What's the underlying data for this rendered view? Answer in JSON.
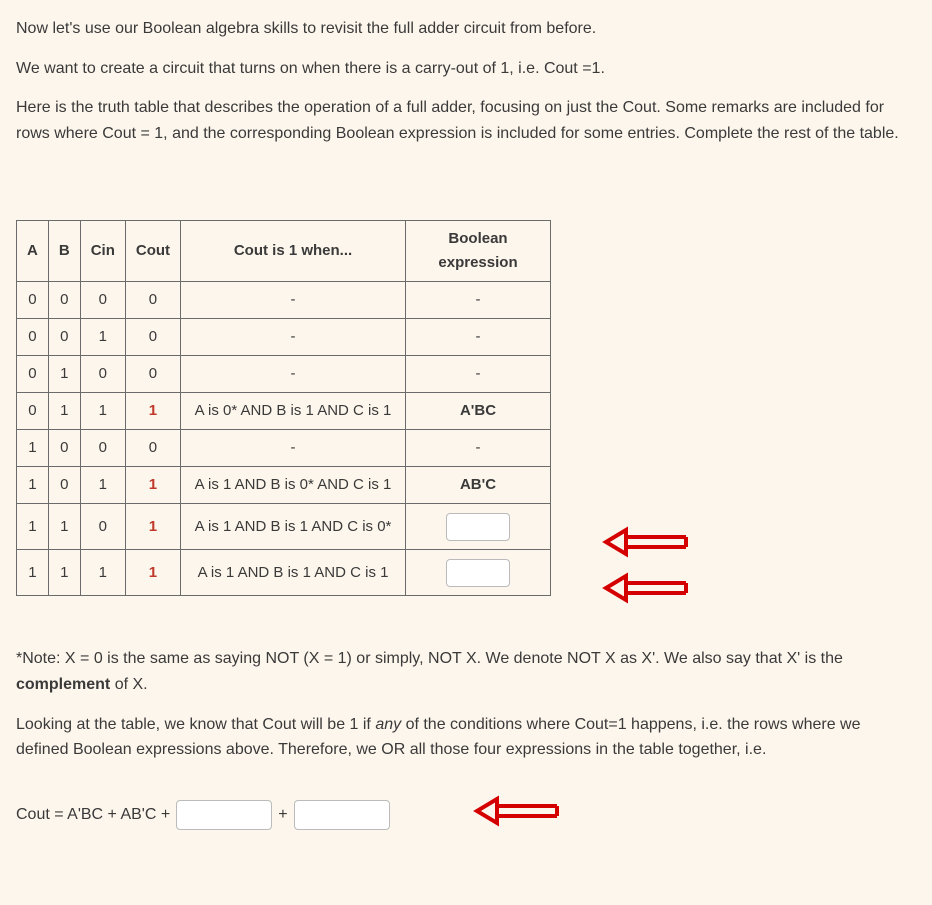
{
  "intro": {
    "p1": "Now let's use our Boolean algebra skills to revisit the full adder circuit from before.",
    "p2": "We want to create a circuit that turns on when there is a carry-out of 1, i.e. Cout =1.",
    "p3": "Here is the truth table that describes the operation of a full adder, focusing on just the Cout. Some remarks are included for rows where Cout = 1, and the corresponding Boolean expression is included for some entries. Complete the rest of the table."
  },
  "table": {
    "headers": {
      "a": "A",
      "b": "B",
      "cin": "Cin",
      "cout": "Cout",
      "when": "Cout is 1 when...",
      "bool": "Boolean expression"
    },
    "rows": [
      {
        "a": "0",
        "b": "0",
        "cin": "0",
        "cout": "0",
        "when": "-",
        "bool": "-",
        "cout1": false,
        "bool_input": false
      },
      {
        "a": "0",
        "b": "0",
        "cin": "1",
        "cout": "0",
        "when": "-",
        "bool": "-",
        "cout1": false,
        "bool_input": false
      },
      {
        "a": "0",
        "b": "1",
        "cin": "0",
        "cout": "0",
        "when": "-",
        "bool": "-",
        "cout1": false,
        "bool_input": false
      },
      {
        "a": "0",
        "b": "1",
        "cin": "1",
        "cout": "1",
        "when": "A is 0* AND B is 1 AND C is 1",
        "bool": "A'BC",
        "cout1": true,
        "bool_input": false,
        "bool_bold": true
      },
      {
        "a": "1",
        "b": "0",
        "cin": "0",
        "cout": "0",
        "when": "-",
        "bool": "-",
        "cout1": false,
        "bool_input": false
      },
      {
        "a": "1",
        "b": "0",
        "cin": "1",
        "cout": "1",
        "when": "A is 1 AND B is 0* AND C is 1",
        "bool": "AB'C",
        "cout1": true,
        "bool_input": false,
        "bool_bold": true
      },
      {
        "a": "1",
        "b": "1",
        "cin": "0",
        "cout": "1",
        "when": "A is 1 AND B is 1 AND C is 0*",
        "bool": "",
        "cout1": true,
        "bool_input": true,
        "arrow": true,
        "tall": true
      },
      {
        "a": "1",
        "b": "1",
        "cin": "1",
        "cout": "1",
        "when": "A is 1 AND B is 1 AND C is 1",
        "bool": "",
        "cout1": true,
        "bool_input": true,
        "arrow": true,
        "tall": true
      }
    ]
  },
  "note": {
    "pre": "*Note: X = 0 is the same as saying NOT (X = 1) or simply, NOT X.  We denote NOT X as X'. We also say that X' is the ",
    "bold": "complement",
    "post": " of X."
  },
  "lookpara": {
    "pre": "Looking at the table, we know that Cout will be 1 if ",
    "em": "any",
    "post": " of the conditions where Cout=1 happens, i.e. the rows where we defined Boolean expressions above. Therefore, we OR all those four expressions in the table together, i.e."
  },
  "equation": {
    "lhs": "Cout = A'BC + AB'C + ",
    "plus": " + "
  }
}
